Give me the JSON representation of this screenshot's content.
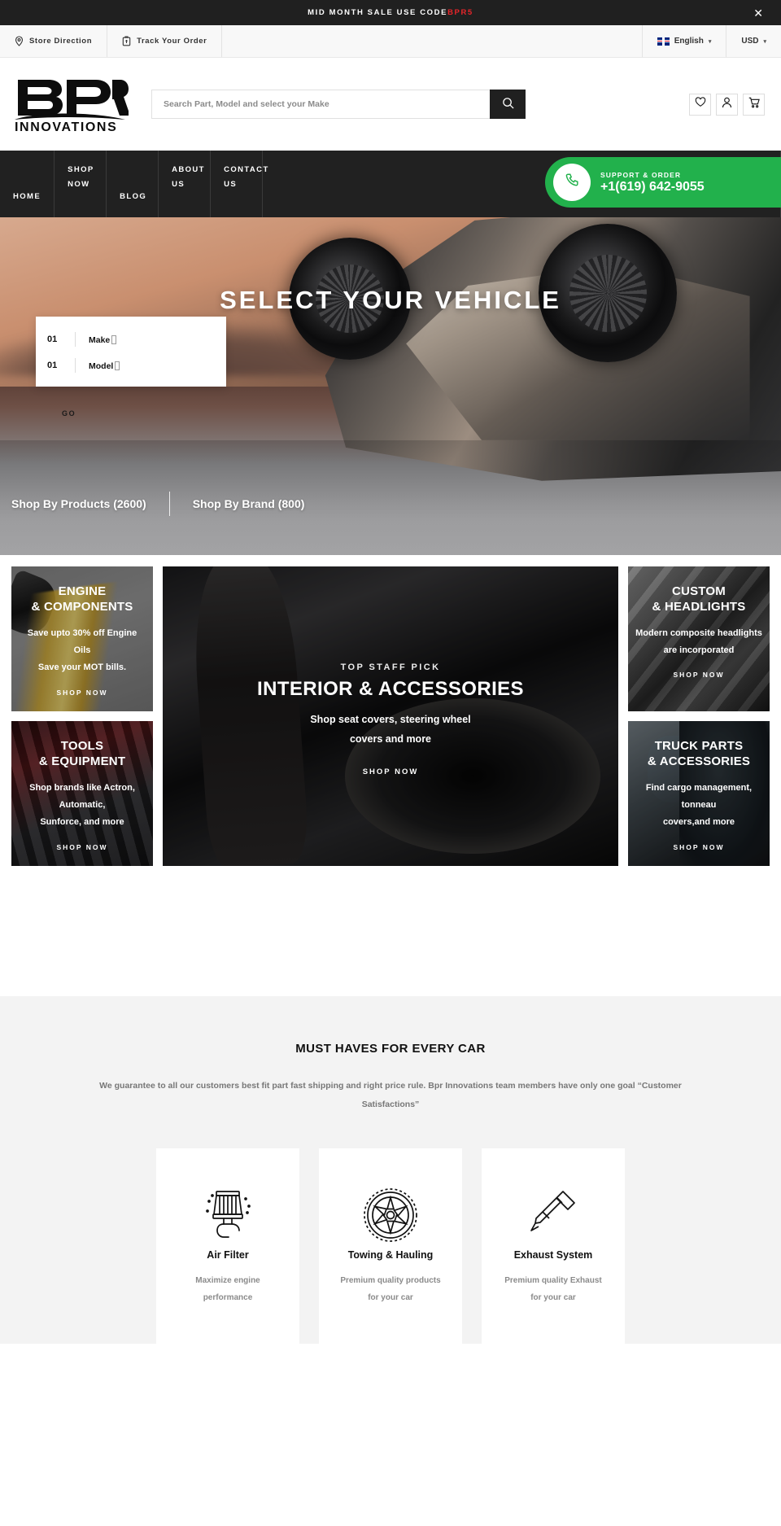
{
  "announcement": {
    "text": "MID MONTH SALE USE CODE",
    "code": "BPR5",
    "close": "✕"
  },
  "utility": {
    "store_direction": "Store Direction",
    "track_order": "Track Your Order",
    "language": "English",
    "currency": "USD",
    "caret": "▾"
  },
  "header": {
    "logo_main": "BPR",
    "logo_sub": "INNOVATIONS",
    "search_placeholder": "Search Part, Model and select your Make",
    "search_value": ""
  },
  "nav": {
    "items": [
      {
        "label": "HOME"
      },
      {
        "label": "SHOP NOW"
      },
      {
        "label": "BLOG"
      },
      {
        "label": "ABOUT US"
      },
      {
        "label": "CONTACT US"
      }
    ]
  },
  "support": {
    "label": "SUPPORT & ORDER",
    "phone": "+1(619) 642-9055"
  },
  "hero": {
    "title": "SELECT YOUR VEHICLE",
    "selector": {
      "rows": [
        {
          "num": "01",
          "label": "Make"
        },
        {
          "num": "01",
          "label": "Model"
        }
      ],
      "go": "GO"
    },
    "shop_by": [
      {
        "label": "Shop By Products (2600)"
      },
      {
        "label": "Shop By Brand (800)"
      }
    ]
  },
  "categories": {
    "left": [
      {
        "kicker": "",
        "title": "ENGINE\n& COMPONENTS",
        "title_line1": "ENGINE",
        "title_line2": "& COMPONENTS",
        "sub_line1": "Save upto 30% off Engine Oils",
        "sub_line2": "Save your MOT bills.",
        "cta": "SHOP NOW"
      },
      {
        "title_line1": "TOOLS",
        "title_line2": "& EQUIPMENT",
        "sub_line1": "Shop brands like Actron, Automatic,",
        "sub_line2": "Sunforce, and more",
        "cta": "SHOP NOW"
      }
    ],
    "center": {
      "kicker": "TOP STAFF PICK",
      "title": "INTERIOR & ACCESSORIES",
      "sub_line1": "Shop seat covers, steering wheel",
      "sub_line2": "covers and more",
      "cta": "SHOP NOW"
    },
    "right": [
      {
        "title_line1": "CUSTOM",
        "title_line2": "& HEADLIGHTS",
        "sub_line1": "Modern composite headlights",
        "sub_line2": "are incorporated",
        "cta": "SHOP NOW"
      },
      {
        "title_line1": "TRUCK PARTS",
        "title_line2": "& ACCESSORIES",
        "sub_line1": "Find cargo management, tonneau",
        "sub_line2": "covers,and more",
        "cta": "SHOP NOW"
      }
    ]
  },
  "must_haves": {
    "title": "MUST HAVES FOR EVERY CAR",
    "description": "We guarantee to all our customers best fit part fast shipping and right price rule. Bpr Innovations team members have only one goal “Customer Satisfactions”",
    "cards": [
      {
        "icon": "air-filter-icon",
        "name": "Air Filter",
        "sub_line1": "Maximize engine",
        "sub_line2": "performance"
      },
      {
        "icon": "wheel-tire-icon",
        "name": "Towing & Hauling",
        "sub_line1": "Premium quality products",
        "sub_line2": "for your car"
      },
      {
        "icon": "exhaust-icon",
        "name": "Exhaust System",
        "sub_line1": "Premium quality Exhaust",
        "sub_line2": "for your car"
      }
    ]
  },
  "colors": {
    "dark": "#212121",
    "accent_red": "#e8252a",
    "support_green": "#22b14c",
    "page_bg": "#ffffff",
    "section_bg": "#f3f3f3"
  }
}
